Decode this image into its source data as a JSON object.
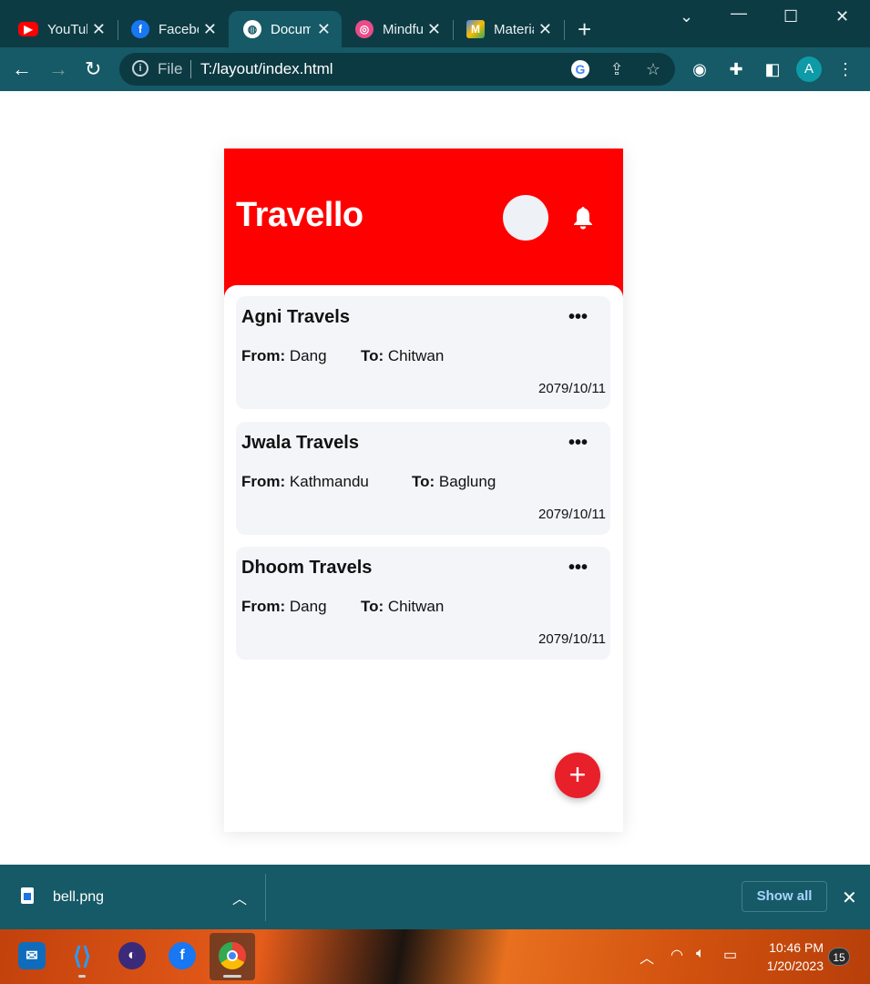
{
  "browser": {
    "tabs": [
      {
        "title": "YouTube",
        "favicon": "youtube-icon",
        "color": "#ff0000",
        "active": false
      },
      {
        "title": "Facebook",
        "favicon": "facebook-icon",
        "color": "#1877f2",
        "active": false
      },
      {
        "title": "Document",
        "favicon": "globe-icon",
        "color": "#155a66",
        "active": true
      },
      {
        "title": "Mindful",
        "favicon": "dribbble-icon",
        "color": "#ea4c89",
        "active": false
      },
      {
        "title": "Material",
        "favicon": "material-icon",
        "color": "#fbbc04",
        "active": false
      }
    ],
    "address": {
      "scheme_label": "File",
      "url": "T:/layout/index.html"
    },
    "profile_initial": "A"
  },
  "app": {
    "brand": "Travello",
    "colors": {
      "header": "#ff0000",
      "card_bg": "#f4f5f9",
      "fab": "#e8202a"
    },
    "bookings": [
      {
        "name": "Agni Travels",
        "from_label": "From:",
        "from": "Dang",
        "to_label": "To:",
        "to": "Chitwan",
        "date": "2079/10/11"
      },
      {
        "name": "Jwala Travels",
        "from_label": "From:",
        "from": "Kathmandu",
        "to_label": "To:",
        "to": "Baglung",
        "date": "2079/10/11"
      },
      {
        "name": "Dhoom Travels",
        "from_label": "From:",
        "from": "Dang",
        "to_label": "To:",
        "to": "Chitwan",
        "date": "2079/10/11"
      }
    ],
    "more_glyph": "•••",
    "fab_glyph": "+"
  },
  "downloads": {
    "file_name": "bell.png",
    "show_all_label": "Show all"
  },
  "taskbar": {
    "apps": [
      "mail-icon",
      "vscode-icon",
      "tor-icon",
      "facebook-icon",
      "chrome-icon"
    ],
    "time": "10:46 PM",
    "date": "1/20/2023",
    "notification_count": "15"
  }
}
